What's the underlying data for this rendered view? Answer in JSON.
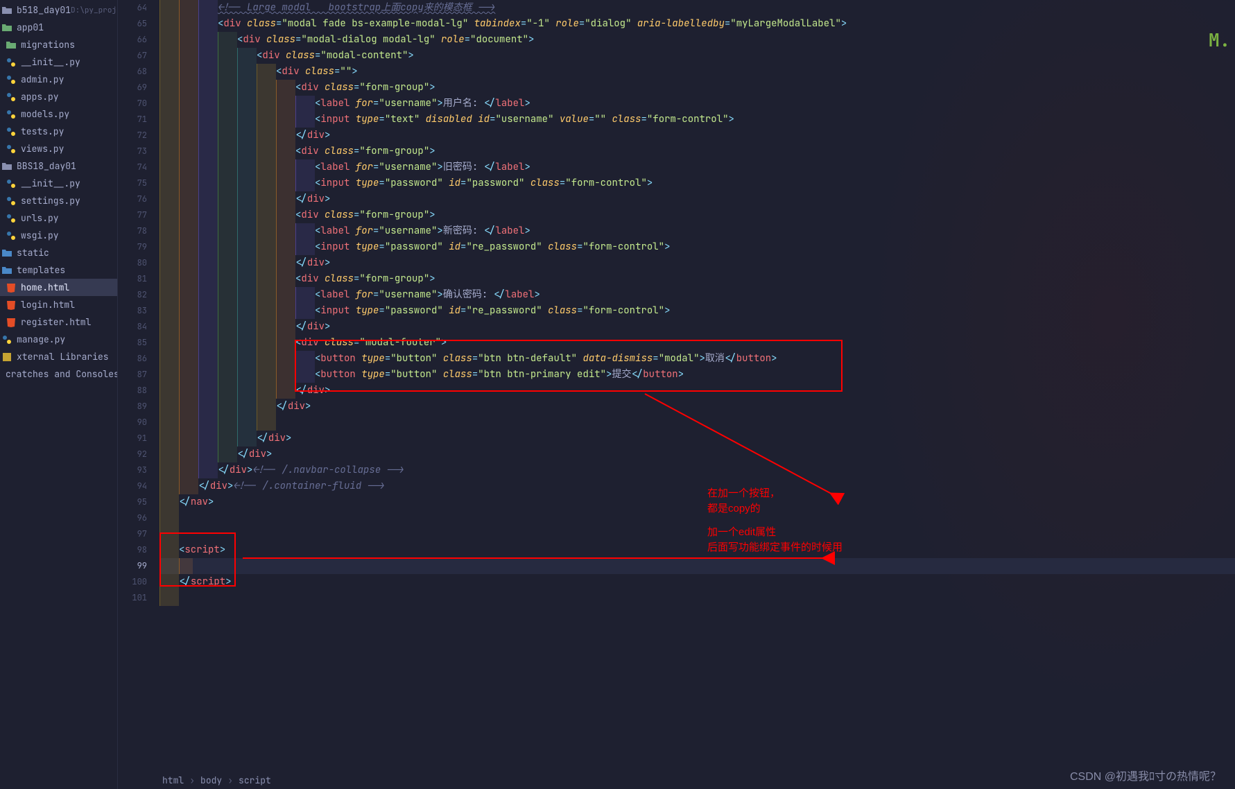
{
  "sidebar": {
    "items": [
      {
        "name": "b518_day01",
        "hint": "D:\\py_proj",
        "icon": "folder",
        "indent": 0
      },
      {
        "name": "app01",
        "icon": "folder-green",
        "indent": 0
      },
      {
        "name": "migrations",
        "icon": "folder-green",
        "indent": 1
      },
      {
        "name": "__init__.py",
        "icon": "py",
        "indent": 1
      },
      {
        "name": "admin.py",
        "icon": "py",
        "indent": 1
      },
      {
        "name": "apps.py",
        "icon": "py",
        "indent": 1
      },
      {
        "name": "models.py",
        "icon": "py",
        "indent": 1
      },
      {
        "name": "tests.py",
        "icon": "py",
        "indent": 1
      },
      {
        "name": "views.py",
        "icon": "py",
        "indent": 1
      },
      {
        "name": "BBS18_day01",
        "icon": "folder",
        "indent": 0
      },
      {
        "name": "__init__.py",
        "icon": "py",
        "indent": 1
      },
      {
        "name": "settings.py",
        "icon": "py",
        "indent": 1
      },
      {
        "name": "urls.py",
        "icon": "py",
        "indent": 1
      },
      {
        "name": "wsgi.py",
        "icon": "py",
        "indent": 1
      },
      {
        "name": "static",
        "icon": "folder-blue",
        "indent": 0
      },
      {
        "name": "templates",
        "icon": "folder-blue",
        "indent": 0
      },
      {
        "name": "home.html",
        "icon": "html",
        "indent": 1,
        "selected": true
      },
      {
        "name": "login.html",
        "icon": "html",
        "indent": 1
      },
      {
        "name": "register.html",
        "icon": "html",
        "indent": 1
      },
      {
        "name": "manage.py",
        "icon": "py",
        "indent": 0
      },
      {
        "name": "xternal Libraries",
        "icon": "lib",
        "indent": 0
      },
      {
        "name": "cratches and Consoles",
        "icon": "scratch",
        "indent": 0
      }
    ]
  },
  "gutter": {
    "start": 64,
    "end": 101,
    "current": 99
  },
  "code": {
    "lines": [
      {
        "n": 64,
        "indent": 3,
        "html": "comment",
        "text": "<!-- Large modal   bootstrap上面copy来的模态框 -->"
      },
      {
        "n": 65,
        "indent": 3,
        "tag": "div",
        "attrs": [
          [
            "class",
            "modal fade bs-example-modal-lg"
          ],
          [
            "tabindex",
            "-1"
          ],
          [
            "role",
            "dialog"
          ],
          [
            "aria-labelledby",
            "myLargeModalLabel"
          ]
        ],
        "close": ">"
      },
      {
        "n": 66,
        "indent": 4,
        "tag": "div",
        "attrs": [
          [
            "class",
            "modal-dialog modal-lg"
          ],
          [
            "role",
            "document"
          ]
        ],
        "close": ">"
      },
      {
        "n": 67,
        "indent": 5,
        "tag": "div",
        "attrs": [
          [
            "class",
            "modal-content"
          ]
        ],
        "close": ">"
      },
      {
        "n": 68,
        "indent": 6,
        "tag": "div",
        "attrs": [
          [
            "class",
            ""
          ]
        ],
        "close": ">"
      },
      {
        "n": 69,
        "indent": 7,
        "tag": "div",
        "attrs": [
          [
            "class",
            "form-group"
          ]
        ],
        "close": ">"
      },
      {
        "n": 70,
        "indent": 8,
        "raw": "<label for=\"username\">用户名: </label>"
      },
      {
        "n": 71,
        "indent": 8,
        "raw": "<input type=\"text\" disabled id=\"username\" value=\"\" class=\"form-control\">"
      },
      {
        "n": 72,
        "indent": 7,
        "closediv": true
      },
      {
        "n": 73,
        "indent": 7,
        "tag": "div",
        "attrs": [
          [
            "class",
            "form-group"
          ]
        ],
        "close": ">"
      },
      {
        "n": 74,
        "indent": 8,
        "raw": "<label for=\"username\">旧密码: </label>"
      },
      {
        "n": 75,
        "indent": 8,
        "raw": "<input type=\"password\" id=\"password\" class=\"form-control\">"
      },
      {
        "n": 76,
        "indent": 7,
        "closediv": true
      },
      {
        "n": 77,
        "indent": 7,
        "tag": "div",
        "attrs": [
          [
            "class",
            "form-group"
          ]
        ],
        "close": ">"
      },
      {
        "n": 78,
        "indent": 8,
        "raw": "<label for=\"username\">新密码: </label>"
      },
      {
        "n": 79,
        "indent": 8,
        "raw": "<input type=\"password\" id=\"re_password\" class=\"form-control\">"
      },
      {
        "n": 80,
        "indent": 7,
        "closediv": true
      },
      {
        "n": 81,
        "indent": 7,
        "tag": "div",
        "attrs": [
          [
            "class",
            "form-group"
          ]
        ],
        "close": ">"
      },
      {
        "n": 82,
        "indent": 8,
        "raw": "<label for=\"username\">确认密码: </label>"
      },
      {
        "n": 83,
        "indent": 8,
        "raw": "<input type=\"password\" id=\"re_password\" class=\"form-control\">"
      },
      {
        "n": 84,
        "indent": 7,
        "closediv": true
      },
      {
        "n": 85,
        "indent": 7,
        "tag": "div",
        "attrs": [
          [
            "class",
            "modal-footer"
          ]
        ],
        "close": ">"
      },
      {
        "n": 86,
        "indent": 8,
        "raw": "<button type=\"button\" class=\"btn btn-default\" data-dismiss=\"modal\">取消</button>"
      },
      {
        "n": 87,
        "indent": 8,
        "raw": "<button type=\"button\" class=\"btn btn-primary edit\">提交</button>",
        "editbox": true
      },
      {
        "n": 88,
        "indent": 7,
        "closediv": true
      },
      {
        "n": 89,
        "indent": 6,
        "closediv": true
      },
      {
        "n": 90,
        "indent": 6,
        "blank": true
      },
      {
        "n": 91,
        "indent": 5,
        "closediv": true
      },
      {
        "n": 92,
        "indent": 4,
        "closediv": true
      },
      {
        "n": 93,
        "indent": 3,
        "closediv": true,
        "comment": "<!-- /.navbar-collapse -->"
      },
      {
        "n": 94,
        "indent": 2,
        "closediv": true,
        "comment": "<!-- /.container-fluid -->"
      },
      {
        "n": 95,
        "indent": 1,
        "closetag": "nav"
      },
      {
        "n": 96,
        "indent": 1,
        "blank": true
      },
      {
        "n": 97,
        "indent": 1,
        "blank": true
      },
      {
        "n": 98,
        "indent": 1,
        "opentag": "script"
      },
      {
        "n": 99,
        "indent": 1,
        "caret": true,
        "current": true
      },
      {
        "n": 100,
        "indent": 1,
        "closetag": "script"
      },
      {
        "n": 101,
        "indent": 1,
        "blank": true
      }
    ]
  },
  "breadcrumb": [
    "html",
    "body",
    "script"
  ],
  "annotations": {
    "line1": "在加一个按钮，",
    "line2": "都是copy的",
    "line3": "加一个edit属性",
    "line4": "后面写功能绑定事件的时候用"
  },
  "watermark": "CSDN @初遇我ﾛ寸の热情呢？",
  "logo": "M."
}
